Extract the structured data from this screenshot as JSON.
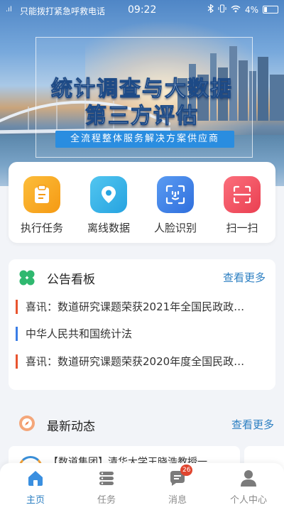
{
  "status_bar": {
    "carrier": "只能拨打紧急呼救电话",
    "time": "09:22",
    "battery": "4%"
  },
  "banner": {
    "title_line1": "统计调查与大数据",
    "title_line2": "第三方评估",
    "tagline": "全流程整体服务解决方案供应商"
  },
  "quick_actions": [
    {
      "label": "执行任务",
      "icon": "clipboard-icon",
      "color": "#f7a21b"
    },
    {
      "label": "离线数据",
      "icon": "location-pin-icon",
      "color": "#35b4e8"
    },
    {
      "label": "人脸识别",
      "icon": "face-scan-icon",
      "color": "#3a7ee6"
    },
    {
      "label": "扫一扫",
      "icon": "scan-icon",
      "color": "#f05262"
    }
  ],
  "notice_board": {
    "title": "公告看板",
    "more": "查看更多",
    "items": [
      {
        "text": "喜讯：数道研究课题荣获2021年全国民政政…",
        "bar_color": "#e8542f"
      },
      {
        "text": "中华人民共和国统计法",
        "bar_color": "#3a7ee6"
      },
      {
        "text": "喜讯：数道研究课题荣获2020年度全国民政…",
        "bar_color": "#e8542f"
      }
    ]
  },
  "latest_news": {
    "title": "最新动态",
    "more": "查看更多",
    "first_item": "【数道集团】清华大学王晓浩教授一"
  },
  "tab_bar": {
    "items": [
      {
        "label": "主页",
        "icon": "home-icon",
        "active": true
      },
      {
        "label": "任务",
        "icon": "tasks-icon",
        "active": false
      },
      {
        "label": "消息",
        "icon": "message-icon",
        "active": false,
        "badge": "26"
      },
      {
        "label": "个人中心",
        "icon": "user-icon",
        "active": false
      }
    ]
  },
  "colors": {
    "accent": "#2c7fc2",
    "background": "#f2f4f8"
  }
}
